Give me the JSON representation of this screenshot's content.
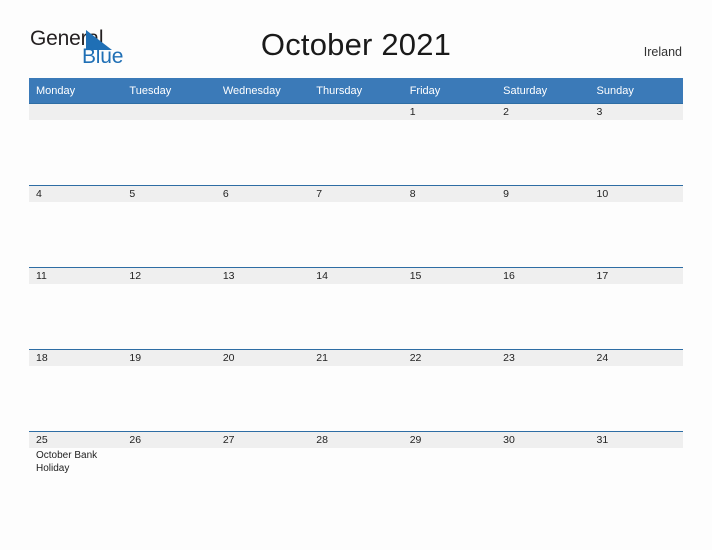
{
  "brand": {
    "name_part1": "General",
    "name_part2": "Blue",
    "triangle_icon": "blue-triangle-icon",
    "color_dark": "#231f20",
    "color_blue": "#1f6fb5"
  },
  "header": {
    "title": "October 2021",
    "country": "Ireland"
  },
  "colors": {
    "header_blue": "#3b7ab8",
    "row_line_blue": "#2e6da4",
    "daynum_band": "#efefef",
    "page_background": "#fdfdfd",
    "text": "#222222"
  },
  "calendar": {
    "month": "October",
    "year": "2021",
    "weekday_headers": [
      "Monday",
      "Tuesday",
      "Wednesday",
      "Thursday",
      "Friday",
      "Saturday",
      "Sunday"
    ],
    "weeks": [
      [
        {
          "day": "",
          "events": []
        },
        {
          "day": "",
          "events": []
        },
        {
          "day": "",
          "events": []
        },
        {
          "day": "",
          "events": []
        },
        {
          "day": "1",
          "events": []
        },
        {
          "day": "2",
          "events": []
        },
        {
          "day": "3",
          "events": []
        }
      ],
      [
        {
          "day": "4",
          "events": []
        },
        {
          "day": "5",
          "events": []
        },
        {
          "day": "6",
          "events": []
        },
        {
          "day": "7",
          "events": []
        },
        {
          "day": "8",
          "events": []
        },
        {
          "day": "9",
          "events": []
        },
        {
          "day": "10",
          "events": []
        }
      ],
      [
        {
          "day": "11",
          "events": []
        },
        {
          "day": "12",
          "events": []
        },
        {
          "day": "13",
          "events": []
        },
        {
          "day": "14",
          "events": []
        },
        {
          "day": "15",
          "events": []
        },
        {
          "day": "16",
          "events": []
        },
        {
          "day": "17",
          "events": []
        }
      ],
      [
        {
          "day": "18",
          "events": []
        },
        {
          "day": "19",
          "events": []
        },
        {
          "day": "20",
          "events": []
        },
        {
          "day": "21",
          "events": []
        },
        {
          "day": "22",
          "events": []
        },
        {
          "day": "23",
          "events": []
        },
        {
          "day": "24",
          "events": []
        }
      ],
      [
        {
          "day": "25",
          "events": [
            "October Bank Holiday"
          ]
        },
        {
          "day": "26",
          "events": []
        },
        {
          "day": "27",
          "events": []
        },
        {
          "day": "28",
          "events": []
        },
        {
          "day": "29",
          "events": []
        },
        {
          "day": "30",
          "events": []
        },
        {
          "day": "31",
          "events": []
        }
      ]
    ]
  }
}
